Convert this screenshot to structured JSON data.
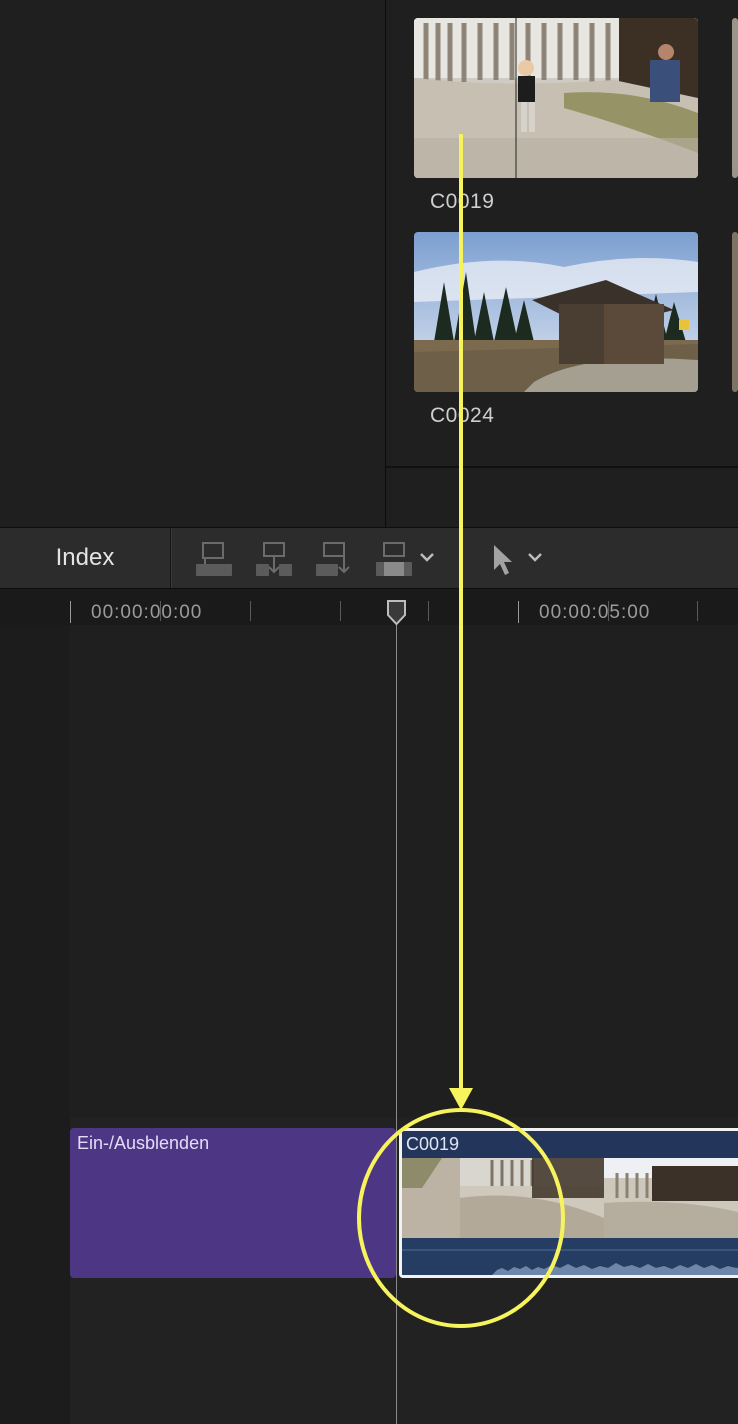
{
  "browser": {
    "clips": [
      {
        "name": "C0019",
        "selected": true
      },
      {
        "name": "C0024",
        "selected": false
      }
    ]
  },
  "toolbar": {
    "index_label": "Index",
    "icons": [
      "connect-clip-icon",
      "insert-clip-icon",
      "append-clip-icon",
      "overwrite-clip-icon",
      "edit-options-chevron-icon",
      "select-tool-icon",
      "tool-options-chevron-icon"
    ]
  },
  "timeline": {
    "timecodes": [
      "00:00:00:00",
      "00:00:05:00"
    ],
    "title_clip": {
      "label": "Ein-/Ausblenden",
      "color": "#4d3785"
    },
    "video_clip": {
      "label": "C0019",
      "color": "#23355a"
    }
  },
  "annotation": {
    "color": "#f7f35c",
    "marks": [
      "drag-arrow",
      "highlight-circle"
    ]
  }
}
